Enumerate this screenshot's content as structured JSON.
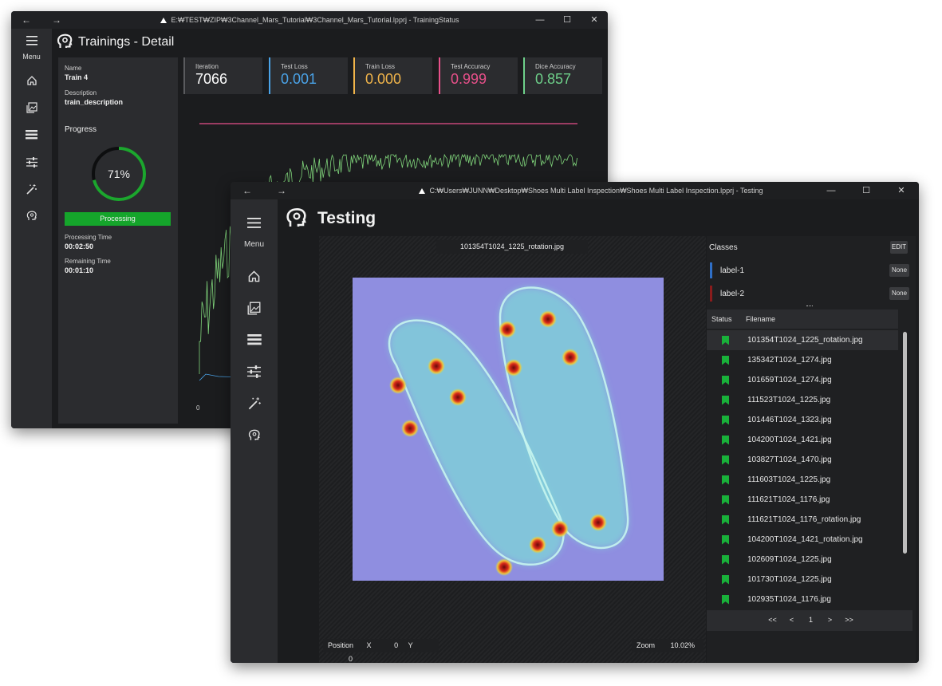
{
  "back_window": {
    "title": "E:₩TEST₩ZIP₩3Channel_Mars_Tutorial₩3Channel_Mars_Tutorial.lpprj - TrainingStatus",
    "page_title": "Trainings - Detail",
    "menu_label": "Menu",
    "name_label": "Name",
    "name_value": "Train 4",
    "description_label": "Description",
    "description_value": "train_description",
    "progress_label": "Progress",
    "progress_percent_text": "71%",
    "progress_fraction": 0.71,
    "status_text": "Processing",
    "processing_time_label": "Processing Time",
    "processing_time_value": "00:02:50",
    "remaining_time_label": "Remaining Time",
    "remaining_time_value": "00:01:10",
    "chart_axis_zero": "0",
    "stats": [
      {
        "label": "Iteration",
        "value": "7066",
        "color": "#ffffff",
        "accent": "#5a5b5e"
      },
      {
        "label": "Test Loss",
        "value": "0.001",
        "color": "#4aa3e8",
        "accent": "#4aa3e8"
      },
      {
        "label": "Train Loss",
        "value": "0.000",
        "color": "#f0b44a",
        "accent": "#f0b44a"
      },
      {
        "label": "Test Accuracy",
        "value": "0.999",
        "color": "#e8508a",
        "accent": "#e8508a"
      },
      {
        "label": "Dice Accuracy",
        "value": "0.857",
        "color": "#6ed08a",
        "accent": "#6ed08a"
      }
    ],
    "colors": {
      "progress": "#1ca62e",
      "status_bar": "#15a52b",
      "test_accuracy_line": "#e8508a",
      "train_line": "#7fd37a"
    },
    "icons": [
      "menu-icon",
      "home-icon",
      "image-icon",
      "list-icon",
      "sliders-icon",
      "magic-wand-icon",
      "brain-icon"
    ]
  },
  "front_window": {
    "title": "C:₩Users₩JUNN₩Desktop₩Shoes Multi Label Inspection₩Shoes Multi Label Inspection.lpprj - Testing",
    "page_title": "Testing",
    "menu_label": "Menu",
    "image_name": "101354T1024_1225_rotation.jpg",
    "position_label": "Position",
    "x_label": "X",
    "x_value": "0",
    "y_label": "Y",
    "y_value": "0",
    "zoom_label": "Zoom",
    "zoom_value": "10.02%",
    "classes_title": "Classes",
    "edit_label": "EDIT",
    "classes": [
      {
        "name": "label-1",
        "color": "#2f6fc7",
        "action": "None"
      },
      {
        "name": "label-2",
        "color": "#8a1c1c",
        "action": "None"
      }
    ],
    "columns": {
      "status": "Status",
      "filename": "Filename"
    },
    "files": [
      "101354T1024_1225_rotation.jpg",
      "135342T1024_1274.jpg",
      "101659T1024_1274.jpg",
      "111523T1024_1225.jpg",
      "101446T1024_1323.jpg",
      "104200T1024_1421.jpg",
      "103827T1024_1470.jpg",
      "111603T1024_1225.jpg",
      "111621T1024_1176.jpg",
      "111621T1024_1176_rotation.jpg",
      "104200T1024_1421_rotation.jpg",
      "102609T1024_1225.jpg",
      "101730T1024_1225.jpg",
      "102935T1024_1176.jpg"
    ],
    "pager": {
      "first": "<<",
      "prev": "<",
      "page": "1",
      "next": ">",
      "last": ">>"
    },
    "icons": [
      "menu-icon",
      "home-icon",
      "image-icon",
      "list-icon",
      "sliders-icon",
      "magic-wand-icon",
      "brain-icon"
    ]
  }
}
